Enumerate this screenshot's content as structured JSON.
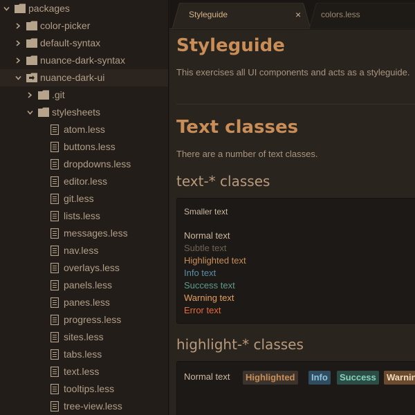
{
  "colors": {
    "tree_bg": "#221d19",
    "editor_bg": "#2a241f",
    "accent": "#c98e57",
    "info": "#5b8fa6",
    "success": "#5f9c8d",
    "warning": "#e6a05c",
    "error": "#e56b3c"
  },
  "tree": {
    "items": [
      {
        "label": "packages",
        "icon": "folder-icon",
        "expanded": true
      },
      {
        "label": "color-picker",
        "icon": "folder-icon",
        "expanded": false
      },
      {
        "label": "default-syntax",
        "icon": "folder-icon",
        "expanded": false
      },
      {
        "label": "nuance-dark-syntax",
        "icon": "folder-icon",
        "expanded": false
      },
      {
        "label": "nuance-dark-ui",
        "icon": "folder-open-icon",
        "expanded": true,
        "selected": true
      },
      {
        "label": ".git",
        "icon": "folder-icon",
        "expanded": false
      },
      {
        "label": "stylesheets",
        "icon": "folder-icon",
        "expanded": true
      },
      {
        "label": "atom.less",
        "icon": "file-icon"
      },
      {
        "label": "buttons.less",
        "icon": "file-icon"
      },
      {
        "label": "dropdowns.less",
        "icon": "file-icon"
      },
      {
        "label": "editor.less",
        "icon": "file-icon"
      },
      {
        "label": "git.less",
        "icon": "file-icon"
      },
      {
        "label": "lists.less",
        "icon": "file-icon"
      },
      {
        "label": "messages.less",
        "icon": "file-icon"
      },
      {
        "label": "nav.less",
        "icon": "file-icon"
      },
      {
        "label": "overlays.less",
        "icon": "file-icon"
      },
      {
        "label": "panels.less",
        "icon": "file-icon"
      },
      {
        "label": "panes.less",
        "icon": "file-icon"
      },
      {
        "label": "progress.less",
        "icon": "file-icon"
      },
      {
        "label": "sites.less",
        "icon": "file-icon"
      },
      {
        "label": "tabs.less",
        "icon": "file-icon"
      },
      {
        "label": "text.less",
        "icon": "file-icon"
      },
      {
        "label": "tooltips.less",
        "icon": "file-icon"
      },
      {
        "label": "tree-view.less",
        "icon": "file-icon"
      }
    ]
  },
  "tabs": [
    {
      "label": "Styleguide",
      "active": true,
      "close": "×"
    },
    {
      "label": "colors.less",
      "active": false
    }
  ],
  "styleguide": {
    "title": "Styleguide",
    "intro": "This exercises all UI components and acts as a styleguide.",
    "text_classes_title": "Text classes",
    "text_classes_intro": "There are a number of text classes.",
    "text_star_title": "text-* classes",
    "smaller_text": "Smaller text",
    "text_samples": [
      {
        "label": "Normal text",
        "color": "#cdb9a0"
      },
      {
        "label": "Subtle text",
        "color": "#6e6254"
      },
      {
        "label": "Highlighted text",
        "color": "#c98e57"
      },
      {
        "label": "Info text",
        "color": "#5b8fa6"
      },
      {
        "label": "Success text",
        "color": "#5f9c8d"
      },
      {
        "label": "Warning text",
        "color": "#e6a05c"
      },
      {
        "label": "Error text",
        "color": "#e56b3c"
      }
    ],
    "highlight_title": "highlight-* classes",
    "highlight_normal": "Normal text",
    "highlights": [
      {
        "label": "Highlighted",
        "bg": "#3c342c",
        "color": "#c98e57"
      },
      {
        "label": "Info",
        "bg": "#2f4d5e",
        "color": "#8ec2de"
      },
      {
        "label": "Success",
        "bg": "#2c4d45",
        "color": "#86d3bc"
      },
      {
        "label": "Warning",
        "bg": "#6a4b30",
        "color": "#f4d9b8"
      }
    ]
  }
}
